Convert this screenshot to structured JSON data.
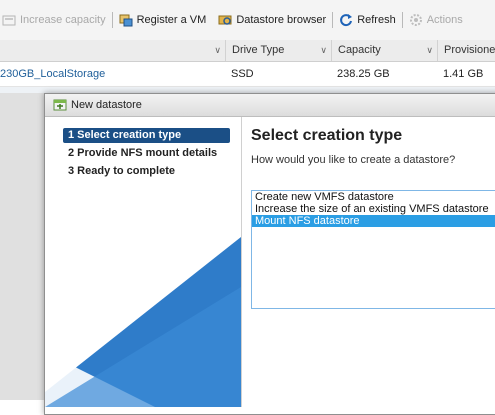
{
  "toolbar": {
    "items": [
      {
        "label": "Increase capacity",
        "icon": "increase-capacity-icon",
        "enabled": false
      },
      {
        "label": "Register a VM",
        "icon": "register-vm-icon",
        "enabled": true
      },
      {
        "label": "Datastore browser",
        "icon": "datastore-browser-icon",
        "enabled": true
      },
      {
        "label": "Refresh",
        "icon": "refresh-icon",
        "enabled": true
      },
      {
        "label": "Actions",
        "icon": "gear-icon",
        "enabled": false
      }
    ]
  },
  "table": {
    "columns": [
      "Drive Type",
      "Capacity",
      "Provisioned"
    ],
    "rows": [
      {
        "name": "230GB_LocalStorage",
        "drive_type": "SSD",
        "capacity": "238.25 GB",
        "provisioned": "1.41 GB"
      }
    ]
  },
  "dialog": {
    "title": "New datastore",
    "steps": [
      "1 Select creation type",
      "2 Provide NFS mount details",
      "3 Ready to complete"
    ],
    "active_step": 0,
    "main_title": "Select creation type",
    "subtitle": "How would you like to create a datastore?",
    "options": [
      "Create new VMFS datastore",
      "Increase the size of an existing VMFS datastore",
      "Mount NFS datastore"
    ],
    "selected_option": 2
  },
  "colors": {
    "accent": "#1b4f86",
    "selection": "#2b9ee4",
    "link": "#1f5f9a",
    "decor_blue": "#2f7cc9"
  }
}
